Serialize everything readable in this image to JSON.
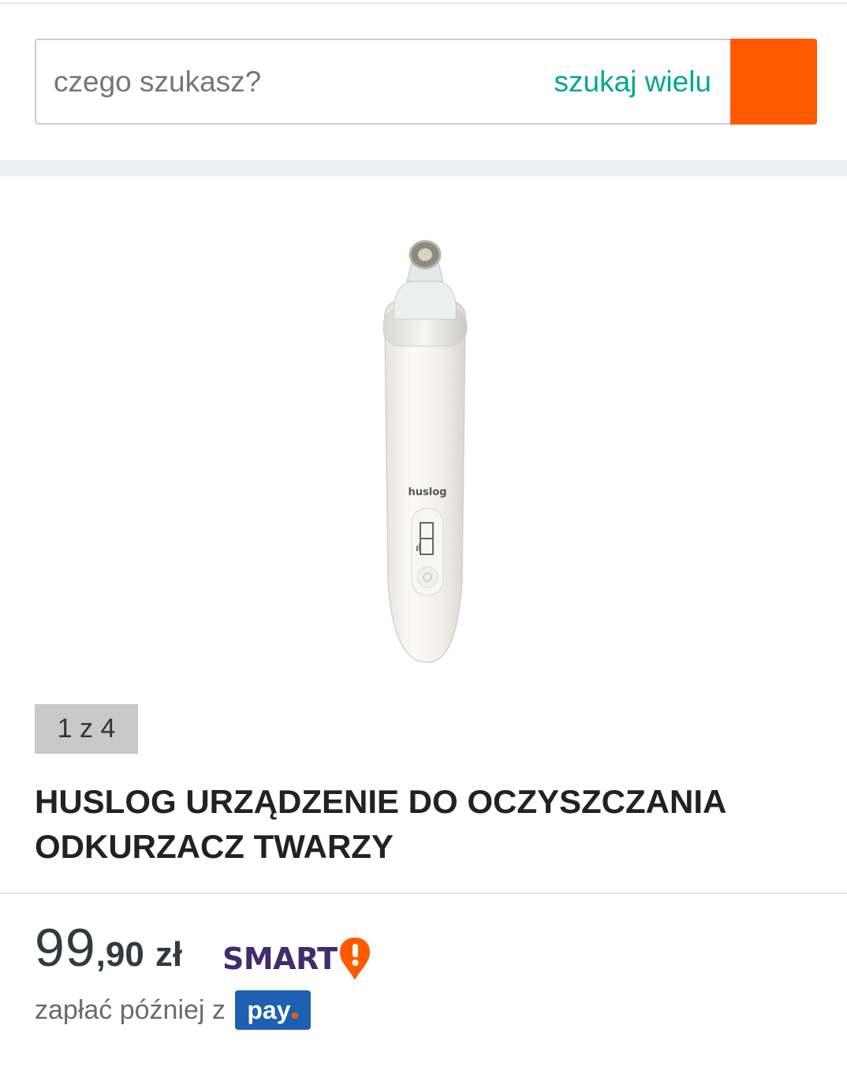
{
  "search": {
    "placeholder": "czego szukasz?",
    "multi_label": "szukaj wielu"
  },
  "gallery": {
    "counter": "1 z 4",
    "brand_on_device": "huslog"
  },
  "product": {
    "title": "HUSLOG URZĄDZENIE DO OCZYSZCZANIA ODKURZACZ TWARZY"
  },
  "price": {
    "integer": "99",
    "fraction": ",90",
    "currency": "zł"
  },
  "smart": {
    "label": "SMART",
    "icon": "exclamation-pin-icon"
  },
  "pay_later": {
    "text": "zapłać później z",
    "pay_label": "pay"
  },
  "colors": {
    "accent_orange": "#ff5a00",
    "link_teal": "#00a790",
    "smart_purple": "#3f2d6d",
    "pay_blue": "#1d5fb0"
  }
}
